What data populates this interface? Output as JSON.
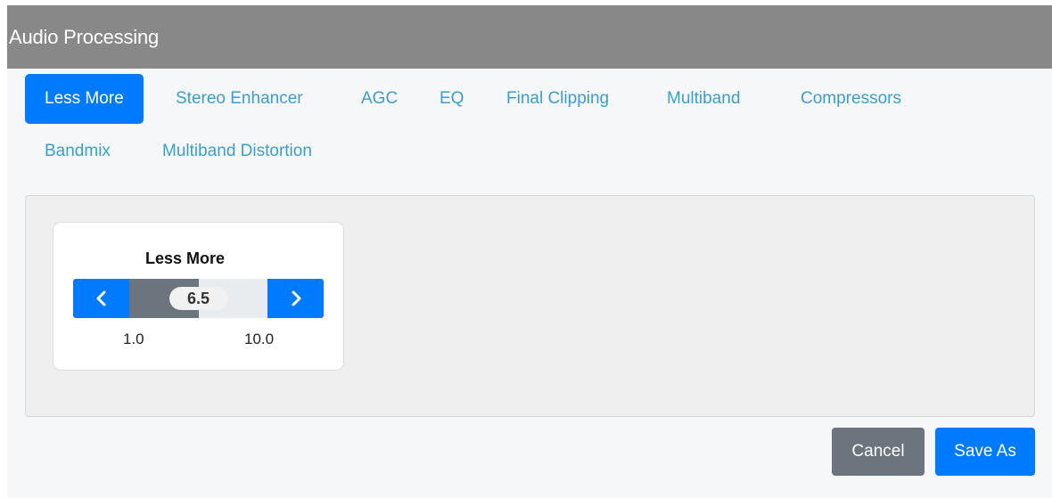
{
  "dialog": {
    "title": "Audio Processing"
  },
  "tabs": [
    {
      "label": "Less More",
      "active": true
    },
    {
      "label": "Stereo Enhancer",
      "active": false
    },
    {
      "label": "AGC",
      "active": false
    },
    {
      "label": "EQ",
      "active": false
    },
    {
      "label": "Final Clipping",
      "active": false
    },
    {
      "label": "Multiband",
      "active": false
    },
    {
      "label": "Compressors",
      "active": false
    },
    {
      "label": "Bandmix",
      "active": false
    },
    {
      "label": "Multiband Distortion",
      "active": false
    }
  ],
  "control": {
    "title": "Less More",
    "value": "6.5",
    "min": "1.0",
    "max": "10.0",
    "level_fraction": 0.5,
    "decrement_icon": "chevron-left-icon",
    "increment_icon": "chevron-right-icon"
  },
  "footer": {
    "cancel_label": "Cancel",
    "save_label": "Save As"
  },
  "colors": {
    "titlebar": "#888888",
    "primary": "#007bff",
    "secondary": "#6c757d",
    "link": "#3b9ed1",
    "background": "#f6f7f9",
    "panel": "#efefef"
  }
}
